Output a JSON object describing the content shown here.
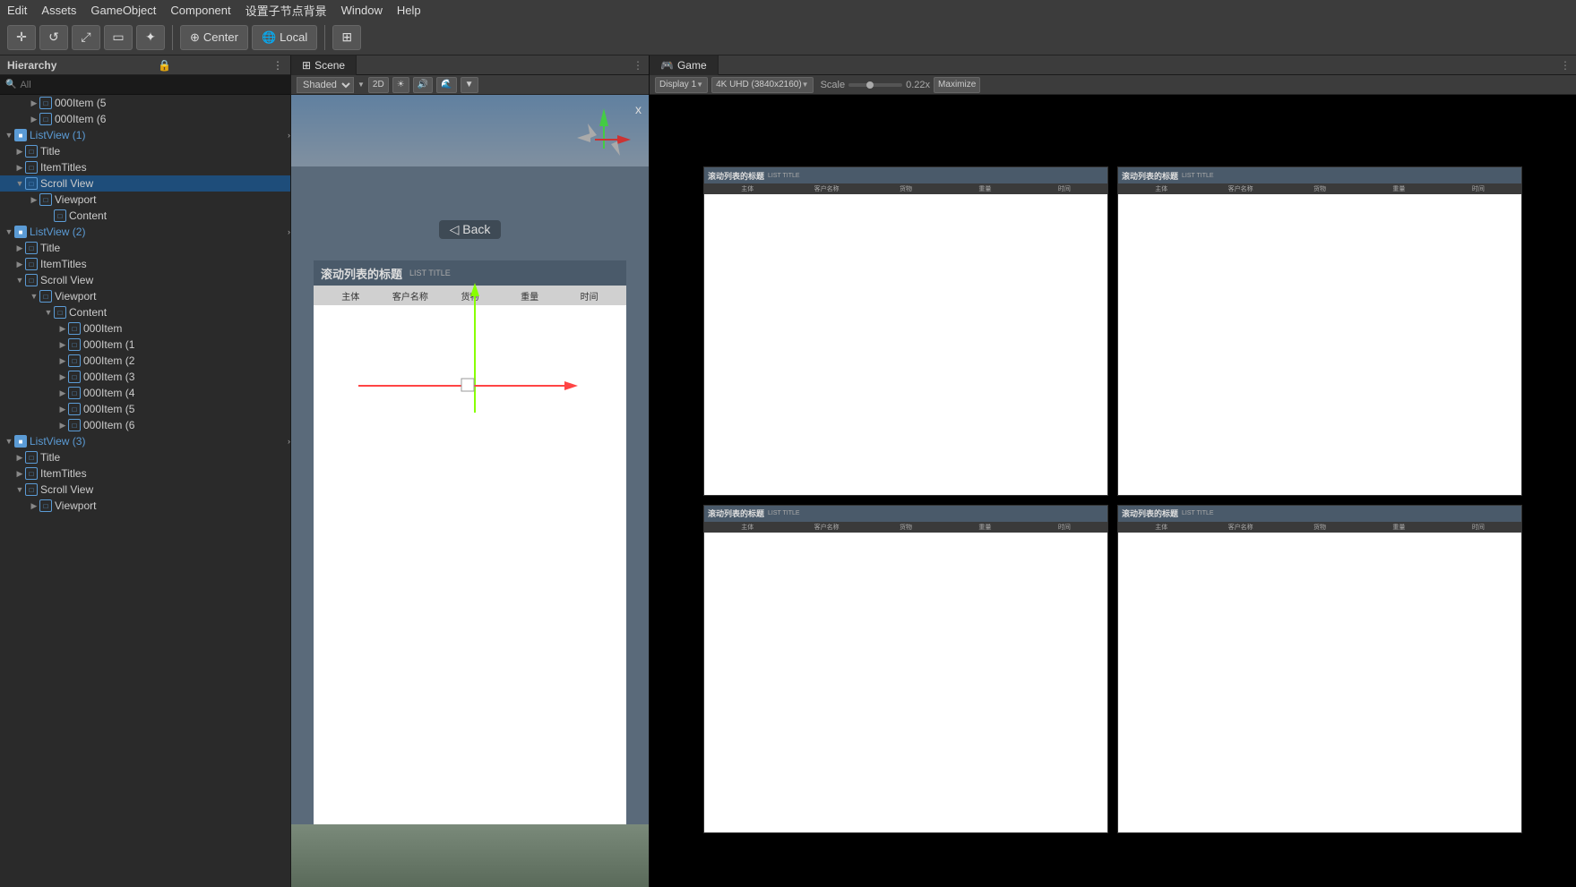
{
  "menubar": {
    "items": [
      "Edit",
      "Assets",
      "GameObject",
      "Component",
      "设置子节点背景",
      "Window",
      "Help"
    ]
  },
  "toolbar": {
    "buttons": [
      {
        "id": "move",
        "icon": "✛"
      },
      {
        "id": "rotate",
        "icon": "↺"
      },
      {
        "id": "scale",
        "icon": "⤢"
      },
      {
        "id": "rect",
        "icon": "▭"
      },
      {
        "id": "transform",
        "icon": "✦"
      },
      {
        "id": "separator"
      },
      {
        "id": "center",
        "label": "Center",
        "icon": "⊕"
      },
      {
        "id": "local",
        "label": "Local",
        "icon": "🌐"
      },
      {
        "id": "separator2"
      },
      {
        "id": "grid",
        "icon": "⊞"
      }
    ]
  },
  "hierarchy": {
    "title": "Hierarchy",
    "search_placeholder": "All",
    "items": [
      {
        "id": "item000_5",
        "label": "000Item (5",
        "indent": 2,
        "arrow": "▶",
        "has_icon": true,
        "icon_type": "cube_outline"
      },
      {
        "id": "item000_6",
        "label": "000Item (6",
        "indent": 2,
        "arrow": "▶",
        "has_icon": true,
        "icon_type": "cube_outline"
      },
      {
        "id": "listview1",
        "label": "ListView (1)",
        "indent": 0,
        "arrow": "▼",
        "has_icon": true,
        "icon_type": "cube",
        "blue": true
      },
      {
        "id": "title1",
        "label": "Title",
        "indent": 1,
        "arrow": "▶",
        "has_icon": true,
        "icon_type": "cube_outline"
      },
      {
        "id": "itemtitles1",
        "label": "ItemTitles",
        "indent": 1,
        "arrow": "▶",
        "has_icon": true,
        "icon_type": "cube_outline"
      },
      {
        "id": "scrollview1",
        "label": "Scroll View",
        "indent": 1,
        "arrow": "▼",
        "has_icon": true,
        "icon_type": "cube_outline"
      },
      {
        "id": "viewport1",
        "label": "Viewport",
        "indent": 2,
        "arrow": "▶",
        "has_icon": true,
        "icon_type": "cube_outline"
      },
      {
        "id": "content1",
        "label": "Content",
        "indent": 3,
        "arrow": "",
        "has_icon": true,
        "icon_type": "cube_outline"
      },
      {
        "id": "listview2",
        "label": "ListView (2)",
        "indent": 0,
        "arrow": "▼",
        "has_icon": true,
        "icon_type": "cube",
        "blue": true
      },
      {
        "id": "title2",
        "label": "Title",
        "indent": 1,
        "arrow": "▶",
        "has_icon": true,
        "icon_type": "cube_outline"
      },
      {
        "id": "itemtitles2",
        "label": "ItemTitles",
        "indent": 1,
        "arrow": "▶",
        "has_icon": true,
        "icon_type": "cube_outline"
      },
      {
        "id": "scrollview2",
        "label": "Scroll View",
        "indent": 1,
        "arrow": "▼",
        "has_icon": true,
        "icon_type": "cube_outline"
      },
      {
        "id": "viewport2",
        "label": "Viewport",
        "indent": 2,
        "arrow": "▼",
        "has_icon": true,
        "icon_type": "cube_outline"
      },
      {
        "id": "content2",
        "label": "Content",
        "indent": 3,
        "arrow": "▼",
        "has_icon": true,
        "icon_type": "cube_outline"
      },
      {
        "id": "item000_a",
        "label": "000Item",
        "indent": 4,
        "arrow": "▶",
        "has_icon": true,
        "icon_type": "cube_outline"
      },
      {
        "id": "item000_1",
        "label": "000Item (1",
        "indent": 4,
        "arrow": "▶",
        "has_icon": true,
        "icon_type": "cube_outline"
      },
      {
        "id": "item000_2",
        "label": "000Item (2",
        "indent": 4,
        "arrow": "▶",
        "has_icon": true,
        "icon_type": "cube_outline"
      },
      {
        "id": "item000_3",
        "label": "000Item (3",
        "indent": 4,
        "arrow": "▶",
        "has_icon": true,
        "icon_type": "cube_outline"
      },
      {
        "id": "item000_4",
        "label": "000Item (4",
        "indent": 4,
        "arrow": "▶",
        "has_icon": true,
        "icon_type": "cube_outline"
      },
      {
        "id": "item000_5b",
        "label": "000Item (5",
        "indent": 4,
        "arrow": "▶",
        "has_icon": true,
        "icon_type": "cube_outline"
      },
      {
        "id": "item000_6b",
        "label": "000Item (6",
        "indent": 4,
        "arrow": "▶",
        "has_icon": true,
        "icon_type": "cube_outline"
      },
      {
        "id": "listview3",
        "label": "ListView (3)",
        "indent": 0,
        "arrow": "▼",
        "has_icon": true,
        "icon_type": "cube",
        "blue": true
      },
      {
        "id": "title3",
        "label": "Title",
        "indent": 1,
        "arrow": "▶",
        "has_icon": true,
        "icon_type": "cube_outline"
      },
      {
        "id": "itemtitles3",
        "label": "ItemTitles",
        "indent": 1,
        "arrow": "▶",
        "has_icon": true,
        "icon_type": "cube_outline"
      },
      {
        "id": "scrollview3",
        "label": "Scroll View",
        "indent": 1,
        "arrow": "▼",
        "has_icon": true,
        "icon_type": "cube_outline"
      },
      {
        "id": "viewport3",
        "label": "Viewport",
        "indent": 2,
        "arrow": "▶",
        "has_icon": true,
        "icon_type": "cube_outline"
      }
    ]
  },
  "scene": {
    "tab_label": "Scene",
    "shading": "Shaded",
    "mode_2d": "2D",
    "back_button": "◁ Back",
    "list_title": "滚动列表的标题",
    "list_subtitle": "LIST TITLE",
    "columns": [
      "主体",
      "客户名称",
      "货物",
      "重量",
      "时间"
    ],
    "close_x": "x"
  },
  "game": {
    "tab_label": "Game",
    "display": "Display 1",
    "resolution": "4K UHD (3840x2160)",
    "scale_label": "Scale",
    "scale_value": "0.22x",
    "maximize_label": "Maximize",
    "cards": [
      {
        "title": "滚动列表的标题",
        "subtitle": "LIST TITLE",
        "columns": [
          "主体",
          "客户名称",
          "货物",
          "重量",
          "时间"
        ]
      },
      {
        "title": "滚动列表的标题",
        "subtitle": "LIST TITLE",
        "columns": [
          "主体",
          "客户名称",
          "货物",
          "重量",
          "时间"
        ]
      },
      {
        "title": "滚动列表的标题",
        "subtitle": "LIST TITLE",
        "columns": [
          "主体",
          "客户名称",
          "货物",
          "重量",
          "时间"
        ]
      },
      {
        "title": "滚动列表的标题",
        "subtitle": "LIST TITLE",
        "columns": [
          "主体",
          "客户名称",
          "货物",
          "重量",
          "时间"
        ]
      }
    ]
  }
}
